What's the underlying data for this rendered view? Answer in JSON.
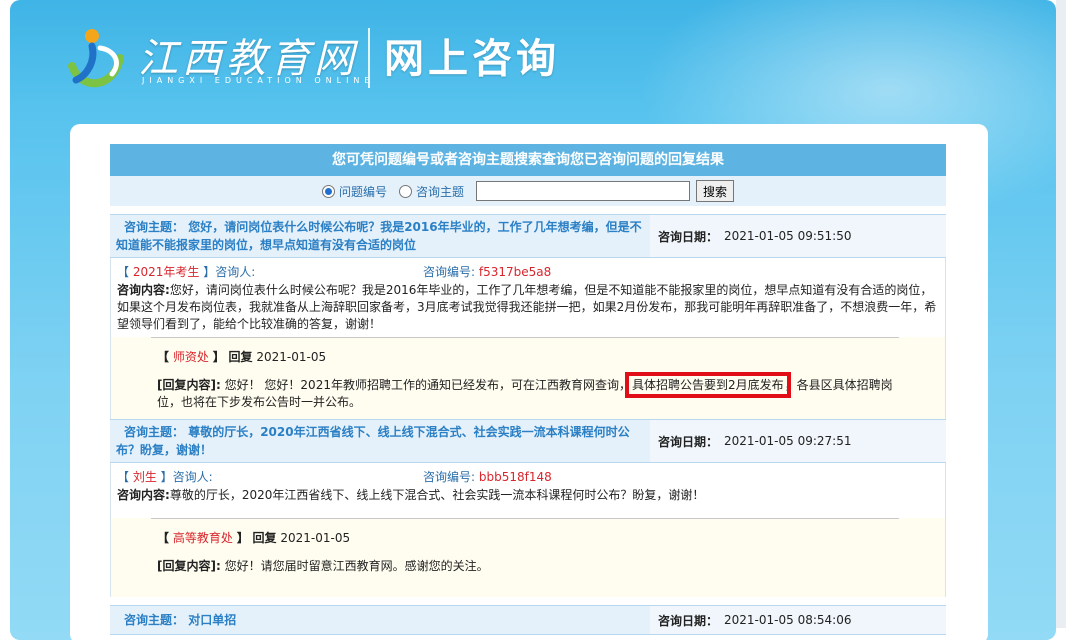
{
  "header": {
    "logo_cn": "江西教育网",
    "logo_en": "JIANGXI EDUCATION ONLINE",
    "section_title": "网上咨询"
  },
  "search": {
    "banner": "您可凭问题编号或者咨询主题搜索查询您已咨询问题的回复结果",
    "option_id": "问题编号",
    "option_topic": "咨询主题",
    "input_value": "",
    "button": "搜索"
  },
  "labels": {
    "topic": "咨询主题：",
    "date": "咨询日期：",
    "asker": "咨询人:",
    "code": "咨询编号:",
    "question": "咨询内容:",
    "reply": "回复",
    "reply_content": "[回复内容]:"
  },
  "entries": [
    {
      "topic": "您好，请问岗位表什么时候公布呢？我是2016年毕业的，工作了几年想考编，但是不知道能不能报家里的岗位，想早点知道有没有合适的岗位",
      "date": "2021-01-05 09:51:50",
      "asker_tag": "2021年考生",
      "code": "f5317be5a8",
      "question": "您好，请问岗位表什么时候公布呢？我是2016年毕业的，工作了几年想考编，但是不知道能不能报家里的岗位，想早点知道有没有合适的岗位，如果这个月发布岗位表，我就准备从上海辞职回家备考，3月底考试我觉得我还能拼一把，如果2月份发布，那我可能明年再辞职准备了，不想浪费一年，希望领导们看到了，能给个比较准确的答复，谢谢！",
      "reply_dept": "师资处",
      "reply_date": "2021-01-05",
      "reply_before": "您好！ 您好！2021年教师招聘工作的通知已经发布，可在江西教育网查询，",
      "reply_highlight": "具体招聘公告要到2月底发布",
      "reply_after": "，各县区具体招聘岗位，也将在下步发布公告时一并公布。"
    },
    {
      "topic": "尊敬的厅长，2020年江西省线下、线上线下混合式、社会实践一流本科课程何时公布？盼复，谢谢！",
      "date": "2021-01-05 09:27:51",
      "asker_tag": "刘生",
      "code": "bbb518f148",
      "question": "尊敬的厅长，2020年江西省线下、线上线下混合式、社会实践一流本科课程何时公布？盼复，谢谢！",
      "reply_dept": "高等教育处",
      "reply_date": "2021-01-05",
      "reply_text": "您好！请您届时留意江西教育网。感谢您的关注。"
    },
    {
      "topic": "对口单招",
      "date": "2021-01-05 08:54:06"
    }
  ]
}
